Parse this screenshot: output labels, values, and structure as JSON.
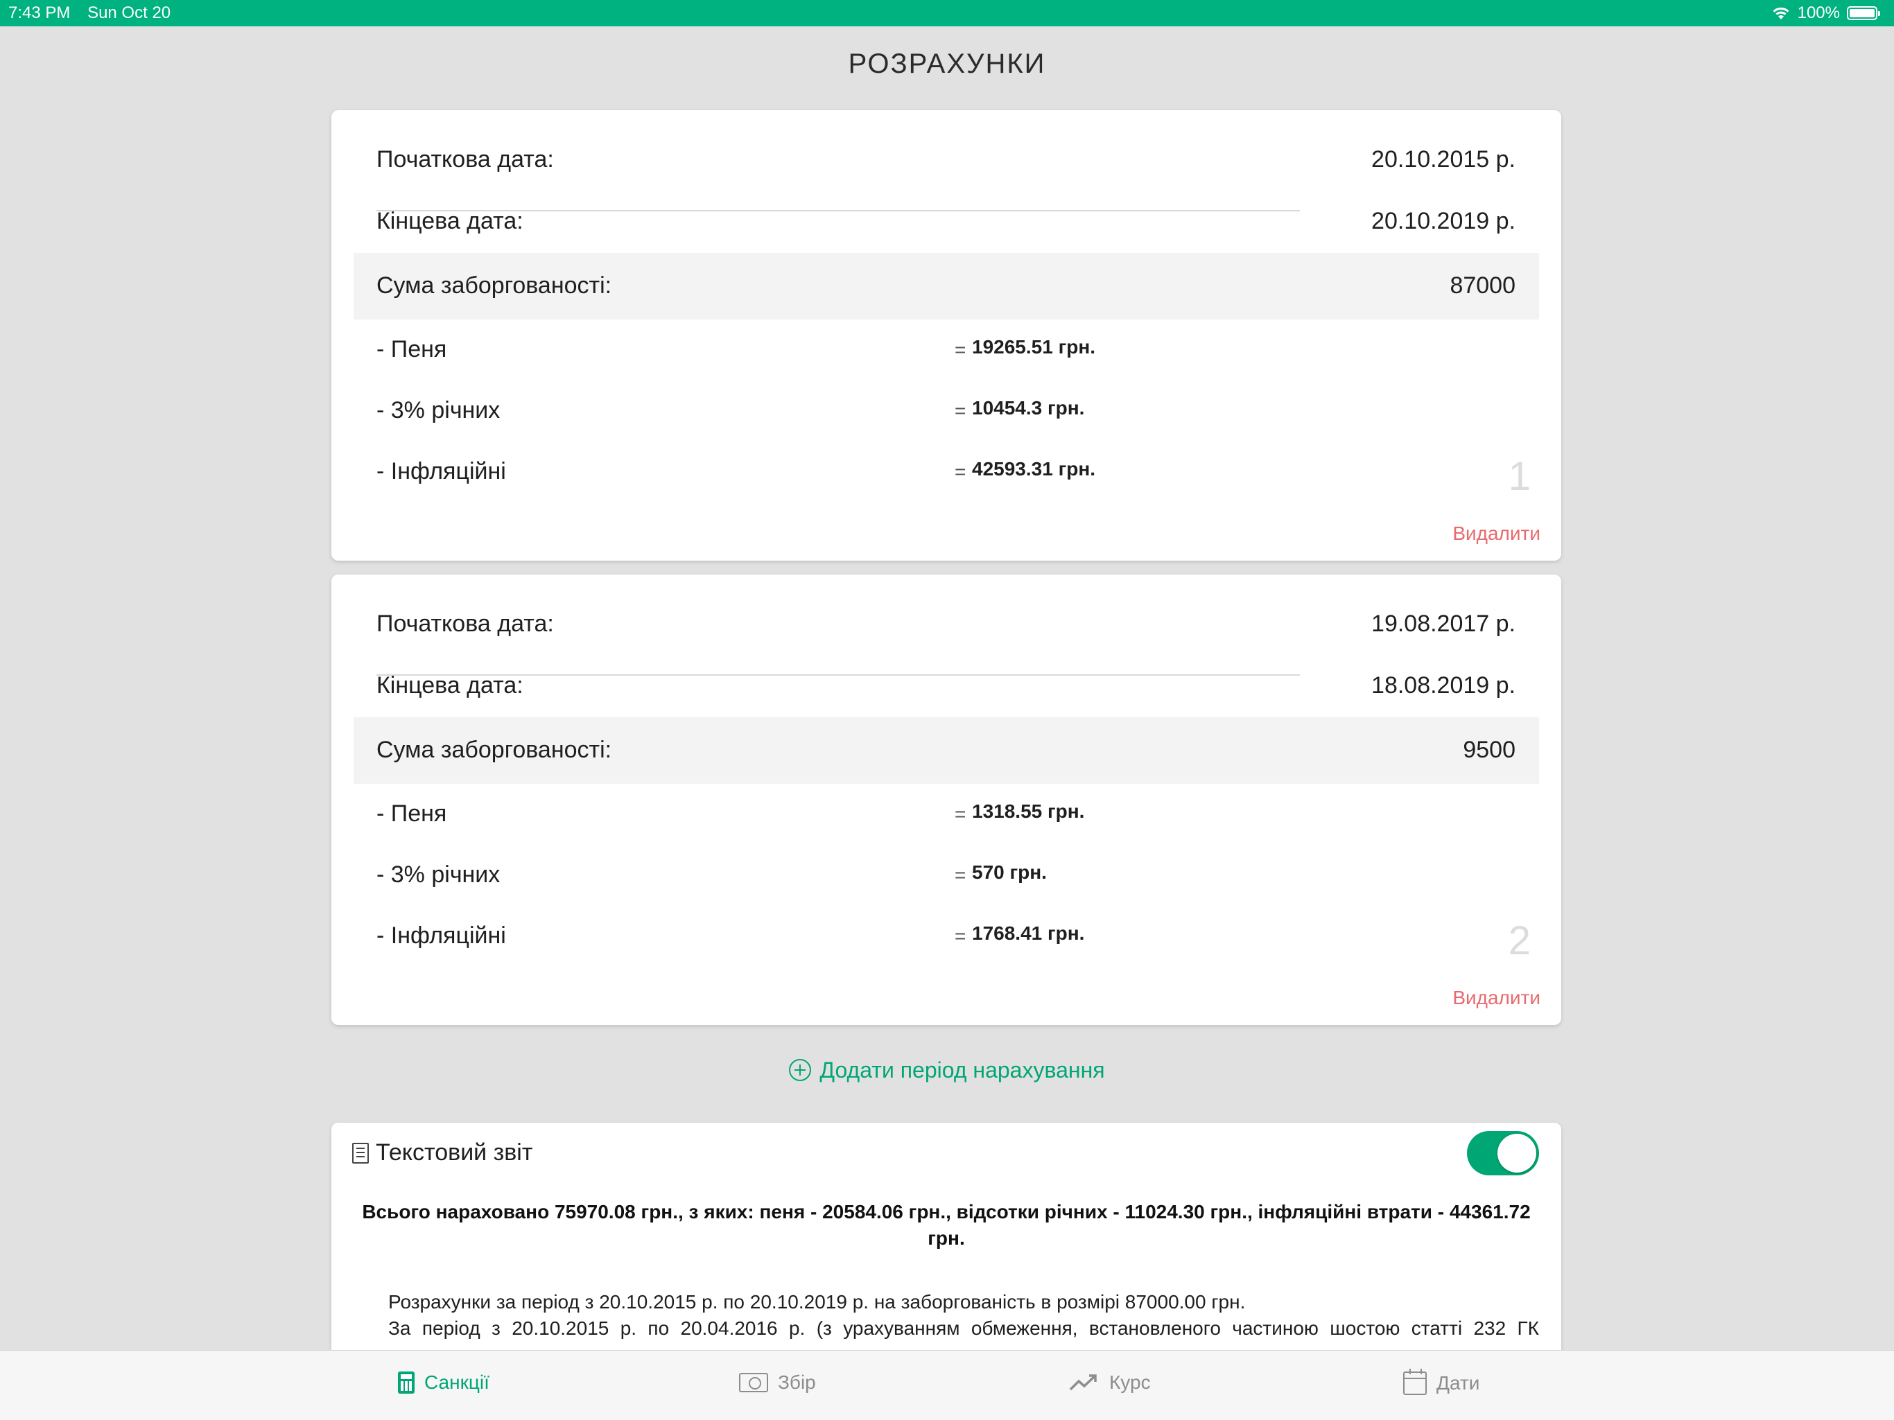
{
  "status_bar": {
    "time": "7:43 PM",
    "date": "Sun Oct 20",
    "battery": "100%"
  },
  "page_title": "РОЗРАХУНКИ",
  "periods": [
    {
      "start_label": "Початкова дата:",
      "start_value": "20.10.2015 р.",
      "end_label": "Кінцева дата:",
      "end_value": "20.10.2019 р.",
      "debt_label": "Сума заборгованості:",
      "debt_value": "87000",
      "penalty_label": "- Пеня",
      "penalty_value": "19265.51 грн.",
      "annual_label": "- 3% річних",
      "annual_value": "10454.3 грн.",
      "inflation_label": "- Інфляційні",
      "inflation_value": "42593.31 грн.",
      "eq": "=",
      "number": "1",
      "delete_label": "Видалити"
    },
    {
      "start_label": "Початкова дата:",
      "start_value": "19.08.2017 р.",
      "end_label": "Кінцева дата:",
      "end_value": "18.08.2019 р.",
      "debt_label": "Сума заборгованості:",
      "debt_value": "9500",
      "penalty_label": "- Пеня",
      "penalty_value": "1318.55 грн.",
      "annual_label": "- 3% річних",
      "annual_value": "570 грн.",
      "inflation_label": "- Інфляційні",
      "inflation_value": "1768.41 грн.",
      "eq": "=",
      "number": "2",
      "delete_label": "Видалити"
    }
  ],
  "add_period_label": "Додати період нарахування",
  "report": {
    "title": "Текстовий звіт",
    "toggle_on": true,
    "summary": "Всього нараховано 75970.08 грн., з яких: пеня - 20584.06 грн., відсотки річних - 11024.30 грн., інфляційні втрати - 44361.72 грн.",
    "line1": "Розрахунки за період з 20.10.2015 р. по 20.10.2019 р. на заборгованість в розмірі 87000.00 грн.",
    "line2": "За період з 20.10.2015 р. по 20.04.2016 р. (з урахуванням обмеження, встановленого частиною шостою статті 232 ГК"
  },
  "tabs": [
    {
      "label": "Санкції",
      "icon": "calculator-icon",
      "active": true
    },
    {
      "label": "Збір",
      "icon": "money-icon",
      "active": false
    },
    {
      "label": "Курс",
      "icon": "trend-icon",
      "active": false
    },
    {
      "label": "Дати",
      "icon": "calendar-icon",
      "active": false
    }
  ],
  "colors": {
    "accent": "#00a674",
    "status_bar": "#00b27f",
    "delete": "#e8696e",
    "background": "#e1e1e1"
  }
}
